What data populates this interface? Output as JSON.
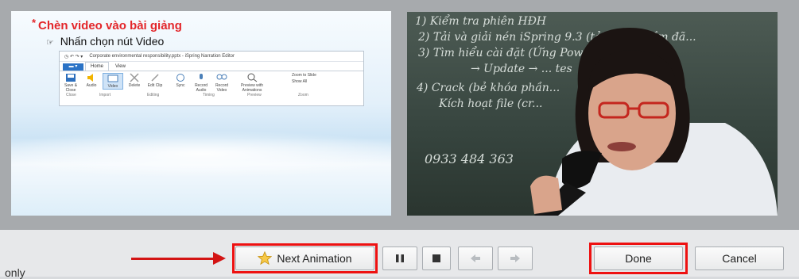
{
  "slide": {
    "title_star": "*",
    "title": "Chèn video vào bài giảng",
    "bullet": "Nhấn chọn  nút Video",
    "ribbon": {
      "window_title": "Corporate environmental responsibility.pptx - iSpring Narration Editor",
      "tabs": [
        "Home",
        "View"
      ],
      "items": [
        "Save & Close",
        "Audio",
        "Video",
        "Delete",
        "Edit Clip",
        "Sync",
        "Record Audio",
        "Record Video",
        "Preview with Animations"
      ],
      "side_items": [
        "Zoom to Slide",
        "Show All"
      ],
      "groups": [
        "Close",
        "Import",
        "Editing",
        "Timing",
        "Preview",
        "Zoom"
      ]
    }
  },
  "webcam": {
    "board_lines": [
      "1) Kiểm tra phiên HĐH",
      "2) Tải và giải nén iSpring 9.3   (tải phần mềm đã...",
      "3) Tìm hiểu cài đặt   (Ứng Powerpoint)",
      "→ Update → ... tes",
      "4) Crack (bẻ khóa phần...",
      "Kích hoạt file  (cr...",
      "0933 484 363"
    ]
  },
  "controls": {
    "next_animation": "Next Animation",
    "done": "Done",
    "cancel": "Cancel",
    "pause_icon": "pause-icon",
    "stop_icon": "stop-icon",
    "prev_icon": "arrow-left-icon",
    "next_icon": "arrow-right-icon"
  },
  "footer": {
    "text": "only"
  },
  "colors": {
    "annotation_red": "#e11111",
    "title_red": "#e3262a"
  }
}
